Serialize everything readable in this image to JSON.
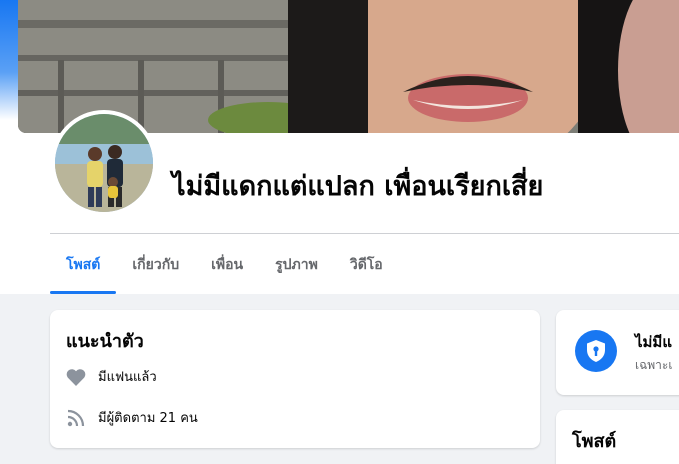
{
  "profile": {
    "name": "ไม่มีแดกแต่แปลก เพื่อนเรียกเสี่ย"
  },
  "tabs": [
    {
      "label": "โพสต์",
      "active": true
    },
    {
      "label": "เกี่ยวกับ",
      "active": false
    },
    {
      "label": "เพื่อน",
      "active": false
    },
    {
      "label": "รูปภาพ",
      "active": false
    },
    {
      "label": "วิดีโอ",
      "active": false
    }
  ],
  "intro": {
    "title": "แนะนำตัว",
    "relationship": "มีแฟนแล้ว",
    "followers": "มีผู้ติดตาม 21 คน"
  },
  "privacy": {
    "title": "ไม่มีแ",
    "subtitle": "เฉพาะเ"
  },
  "posts": {
    "title": "โพสต์"
  },
  "colors": {
    "accent": "#1877f2",
    "background": "#f0f2f5",
    "text": "#050505",
    "secondary_text": "#65676b"
  },
  "icons": {
    "relationship": "heart-icon",
    "followers": "rss-icon",
    "privacy": "shield-lock-icon"
  }
}
